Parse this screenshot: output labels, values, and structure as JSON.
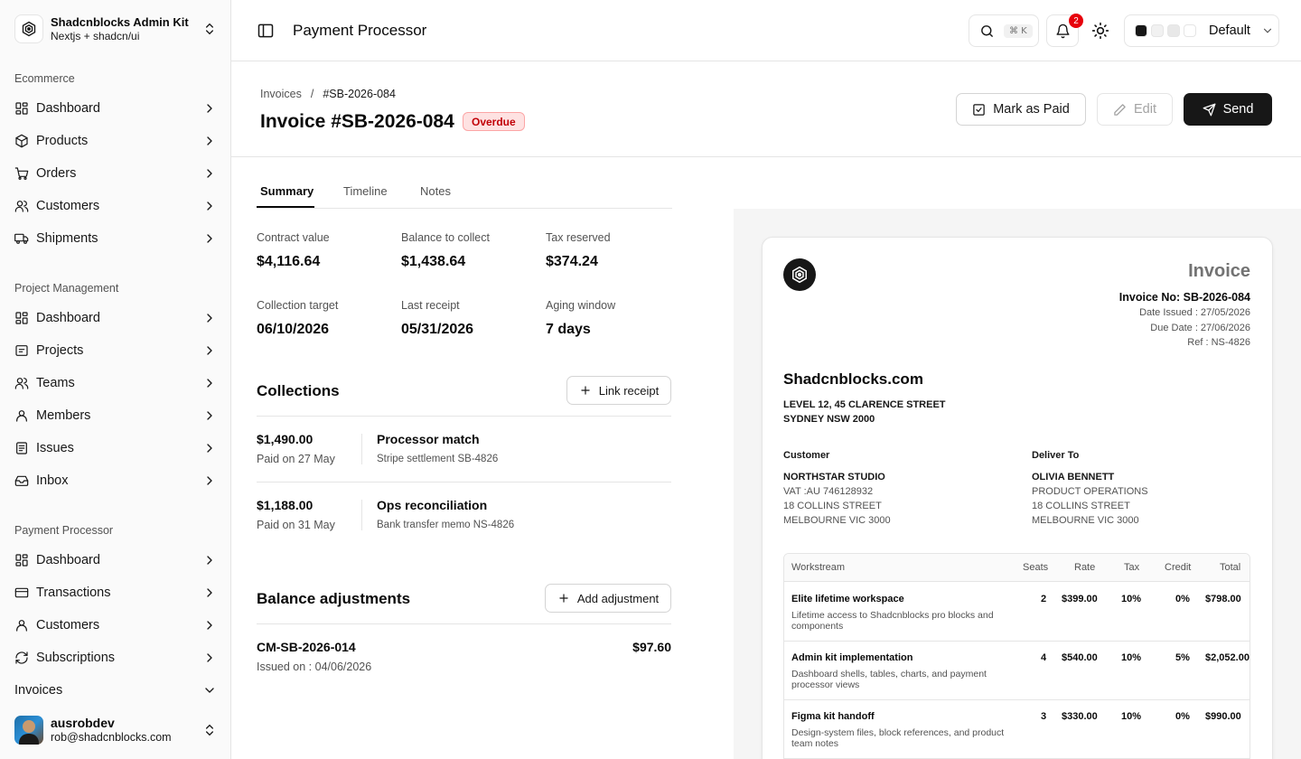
{
  "brand": {
    "title": "Shadcnblocks Admin Kit",
    "subtitle": "Nextjs + shadcn/ui"
  },
  "sidebar": {
    "groups": [
      {
        "label": "Ecommerce",
        "items": [
          {
            "label": "Dashboard",
            "icon": "dashboard-icon"
          },
          {
            "label": "Products",
            "icon": "package-icon"
          },
          {
            "label": "Orders",
            "icon": "cart-icon"
          },
          {
            "label": "Customers",
            "icon": "users-icon"
          },
          {
            "label": "Shipments",
            "icon": "truck-icon"
          }
        ]
      },
      {
        "label": "Project Management",
        "items": [
          {
            "label": "Dashboard",
            "icon": "dashboard-icon"
          },
          {
            "label": "Projects",
            "icon": "projects-icon"
          },
          {
            "label": "Teams",
            "icon": "users-icon"
          },
          {
            "label": "Members",
            "icon": "user-icon"
          },
          {
            "label": "Issues",
            "icon": "issues-icon"
          },
          {
            "label": "Inbox",
            "icon": "inbox-icon"
          }
        ]
      },
      {
        "label": "Payment Processor",
        "items": [
          {
            "label": "Dashboard",
            "icon": "dashboard-icon"
          },
          {
            "label": "Transactions",
            "icon": "card-icon"
          },
          {
            "label": "Customers",
            "icon": "user-icon"
          },
          {
            "label": "Subscriptions",
            "icon": "refresh-icon"
          },
          {
            "label": "Invoices",
            "icon": "none",
            "expanded": true
          }
        ]
      }
    ],
    "user": {
      "name": "ausrobdev",
      "email": "rob@shadcnblocks.com"
    }
  },
  "header": {
    "title": "Payment Processor",
    "search_kbd": "⌘ K",
    "notifications_count": "2",
    "theme_label": "Default",
    "theme_swatches": [
      "#171717",
      "#f1f1f1",
      "#e8e8e8",
      "#ffffff"
    ]
  },
  "page": {
    "breadcrumb": {
      "parent": "Invoices",
      "separator": "/",
      "current": "#SB-2026-084"
    },
    "title": "Invoice #SB-2026-084",
    "status": "Overdue",
    "actions": {
      "mark_paid": "Mark as Paid",
      "edit": "Edit",
      "send": "Send"
    }
  },
  "tabs": [
    {
      "label": "Summary",
      "active": true
    },
    {
      "label": "Timeline",
      "active": false
    },
    {
      "label": "Notes",
      "active": false
    }
  ],
  "stats": [
    {
      "label": "Contract value",
      "value": "$4,116.64"
    },
    {
      "label": "Balance to collect",
      "value": "$1,438.64"
    },
    {
      "label": "Tax reserved",
      "value": "$374.24"
    },
    {
      "label": "Collection target",
      "value": "06/10/2026"
    },
    {
      "label": "Last receipt",
      "value": "05/31/2026"
    },
    {
      "label": "Aging window",
      "value": "7 days"
    }
  ],
  "collections": {
    "title": "Collections",
    "button": "Link receipt",
    "items": [
      {
        "amount": "$1,490.00",
        "date": "Paid on 27 May",
        "title": "Processor match",
        "detail": "Stripe settlement SB-4826"
      },
      {
        "amount": "$1,188.00",
        "date": "Paid on 31 May",
        "title": "Ops reconciliation",
        "detail": "Bank transfer memo NS-4826"
      }
    ]
  },
  "adjustments": {
    "title": "Balance adjustments",
    "button": "Add adjustment",
    "items": [
      {
        "id": "CM-SB-2026-014",
        "date": "Issued on : 04/06/2026",
        "amount": "$97.60"
      }
    ]
  },
  "invoice_doc": {
    "heading": "Invoice",
    "number": "Invoice No: SB-2026-084",
    "date_issued": "Date Issued : 27/05/2026",
    "due_date": "Due Date : 27/06/2026",
    "ref": "Ref : NS-4826",
    "company": "Shadcnblocks.com",
    "company_address": [
      "LEVEL 12, 45 CLARENCE STREET",
      "SYDNEY NSW 2000"
    ],
    "customer": {
      "label": "Customer",
      "name": "NORTHSTAR STUDIO",
      "lines": [
        "VAT :AU 746128932",
        "18 COLLINS STREET",
        "MELBOURNE VIC 3000"
      ]
    },
    "deliver_to": {
      "label": "Deliver To",
      "name": "OLIVIA BENNETT",
      "lines": [
        "PRODUCT OPERATIONS",
        "18 COLLINS STREET",
        "MELBOURNE VIC 3000"
      ]
    },
    "table": {
      "columns": [
        "Workstream",
        "Seats",
        "Rate",
        "Tax",
        "Credit",
        "Total"
      ],
      "rows": [
        {
          "name": "Elite lifetime workspace",
          "desc": "Lifetime access to Shadcnblocks pro blocks and components",
          "seats": "2",
          "rate": "$399.00",
          "tax": "10%",
          "credit": "0%",
          "total": "$798.00"
        },
        {
          "name": "Admin kit implementation",
          "desc": "Dashboard shells, tables, charts, and payment processor views",
          "seats": "4",
          "rate": "$540.00",
          "tax": "10%",
          "credit": "5%",
          "total": "$2,052.00"
        },
        {
          "name": "Figma kit handoff",
          "desc": "Design-system files, block references, and product team notes",
          "seats": "3",
          "rate": "$330.00",
          "tax": "10%",
          "credit": "0%",
          "total": "$990.00"
        }
      ]
    }
  }
}
